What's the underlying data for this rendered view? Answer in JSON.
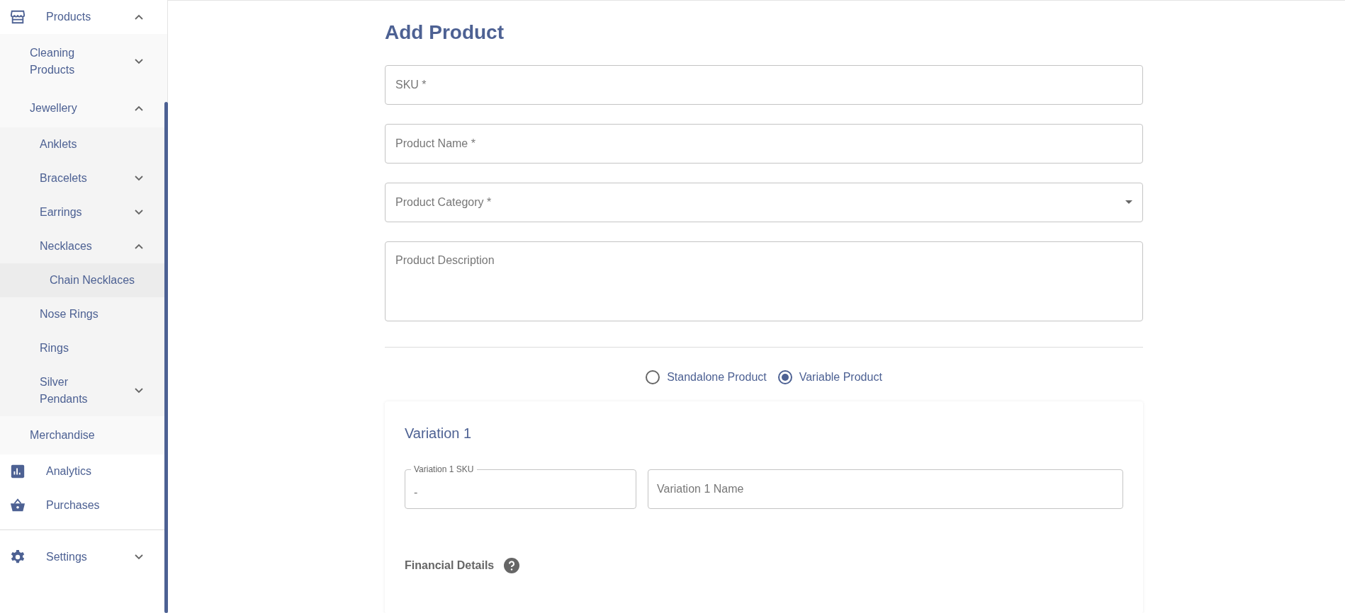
{
  "sidebar": {
    "items": [
      {
        "label": "Products",
        "expanded": true,
        "children": [
          {
            "label": "Cleaning Products",
            "expanded": false
          },
          {
            "label": "Jewellery",
            "expanded": true,
            "children": [
              {
                "label": "Anklets"
              },
              {
                "label": "Bracelets",
                "expanded": false
              },
              {
                "label": "Earrings",
                "expanded": false
              },
              {
                "label": "Necklaces",
                "expanded": true,
                "children": [
                  {
                    "label": "Chain Necklaces"
                  }
                ]
              },
              {
                "label": "Nose Rings"
              },
              {
                "label": "Rings"
              },
              {
                "label": "Silver Pendants",
                "expanded": false
              }
            ]
          },
          {
            "label": "Merchandise"
          }
        ]
      },
      {
        "label": "Analytics"
      },
      {
        "label": "Purchases"
      }
    ],
    "footer_items": [
      {
        "label": "Settings",
        "expanded": false
      }
    ]
  },
  "page": {
    "title": "Add Product",
    "fields": [
      {
        "kind": "text",
        "placeholder": "SKU *"
      },
      {
        "kind": "text",
        "placeholder": "Product Name *"
      },
      {
        "kind": "select",
        "placeholder": "Product Category *"
      },
      {
        "kind": "textarea",
        "placeholder": "Product Description"
      }
    ],
    "product_type": [
      {
        "label": "Standalone Product",
        "selected": false
      },
      {
        "label": "Variable Product",
        "selected": true
      }
    ],
    "variation": {
      "title": "Variation 1",
      "sku": {
        "label": "Variation 1 SKU",
        "value": "-"
      },
      "name": {
        "placeholder": "Variation 1 Name"
      },
      "financial_heading": "Financial Details"
    }
  }
}
